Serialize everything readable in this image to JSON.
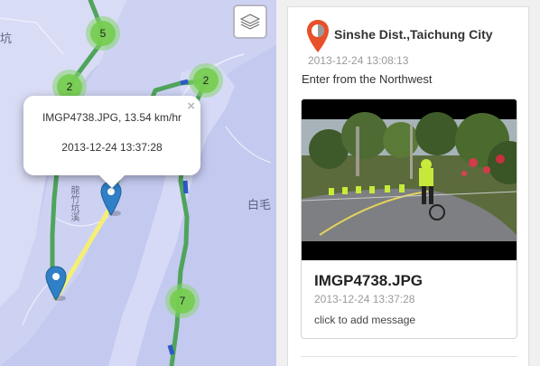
{
  "map": {
    "clusters": [
      "5",
      "2",
      "2",
      "7"
    ],
    "labels": {
      "top_left_char": "坑",
      "right_label": "白毛",
      "road_vertical": "龍竹坑溪"
    },
    "popup": {
      "line1": "IMGP4738.JPG, 13.54 km/hr",
      "line2": "2013-12-24 13:37:28",
      "close_symbol": "×"
    },
    "colors": {
      "water": "#c3c9ef",
      "land": "#dcdff6",
      "route": "#4fa45b",
      "active_segment": "#f4ef74",
      "marker": "#2f80c6"
    }
  },
  "panel": {
    "location_title": "Sinshe Dist.,Taichung City",
    "location_time": "2013-12-24 13:08:13",
    "location_message": "Enter from the Northwest",
    "card": {
      "title": "IMGP4738.JPG",
      "time": "2013-12-24 13:37:28",
      "add_message": "click to add message"
    },
    "icon_color": "#e8502a"
  }
}
